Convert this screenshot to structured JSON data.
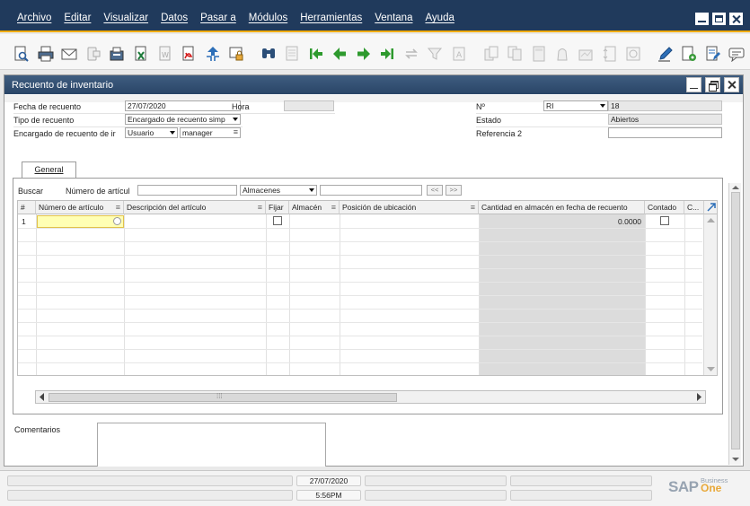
{
  "menu": [
    "Archivo",
    "Editar",
    "Visualizar",
    "Datos",
    "Pasar a",
    "Módulos",
    "Herramientas",
    "Ventana",
    "Ayuda"
  ],
  "window_title": "Recuento de inventario",
  "header": {
    "fecha_label": "Fecha de recuento",
    "fecha_value": "27/07/2020",
    "hora_label": "Hora",
    "hora_value": "",
    "tipo_label": "Tipo de recuento",
    "tipo_value": "Encargado de recuento simp",
    "encargado_label": "Encargado de recuento de ir",
    "encargado_tipo": "Usuario",
    "encargado_value": "manager",
    "no_label": "Nº",
    "serie_value": "RI",
    "numero_value": "18",
    "estado_label": "Estado",
    "estado_value": "Abiertos",
    "referencia_label": "Referencia 2",
    "referencia_value": ""
  },
  "tabs": [
    "General"
  ],
  "search": {
    "label": "Buscar",
    "field_label": "Número de artícul",
    "field_value": "",
    "warehouse_select": "Almacenes",
    "warehouse_value": "",
    "prev_label": "<<",
    "next_label": ">>"
  },
  "grid": {
    "columns": [
      "#",
      "Número de artículo",
      "Descripción del artículo",
      "Fijar",
      "Almacén",
      "Posición de ubicación",
      "Cantidad en almacén en fecha de recuento",
      "Contado",
      "C..."
    ],
    "rows": [
      {
        "num": "1",
        "item": "",
        "desc": "",
        "warehouse": "",
        "location": "",
        "qty": "0.0000"
      }
    ]
  },
  "comments_label": "Comentarios",
  "comments_value": "",
  "status": {
    "date": "27/07/2020",
    "time": "5:56PM"
  },
  "brand": {
    "logo": "SAP",
    "product_top": "Business",
    "product_bottom": "One"
  },
  "colors": {
    "menubar": "#203a5c",
    "accent": "#f0ab00",
    "selected_cell": "#ffffb4"
  }
}
